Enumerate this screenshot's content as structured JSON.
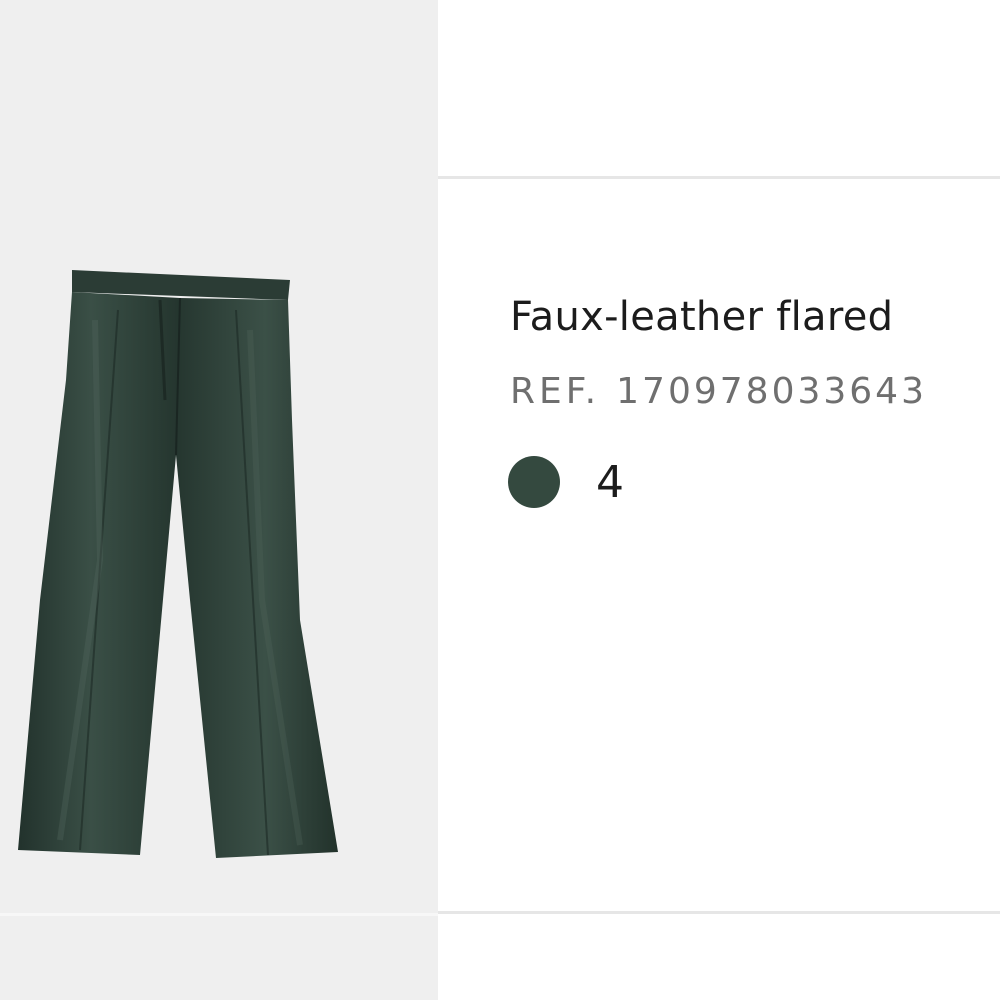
{
  "product": {
    "title": "Faux-leather flared",
    "ref_label": "REF.",
    "ref_number": "170978033643",
    "color_swatch": "#34493f",
    "color_count": "4",
    "image_icon": "faux-leather-trousers-icon"
  },
  "colors": {
    "image_background": "#efefef",
    "garment": "#2c3d36",
    "divider": "#e6e6e6"
  }
}
